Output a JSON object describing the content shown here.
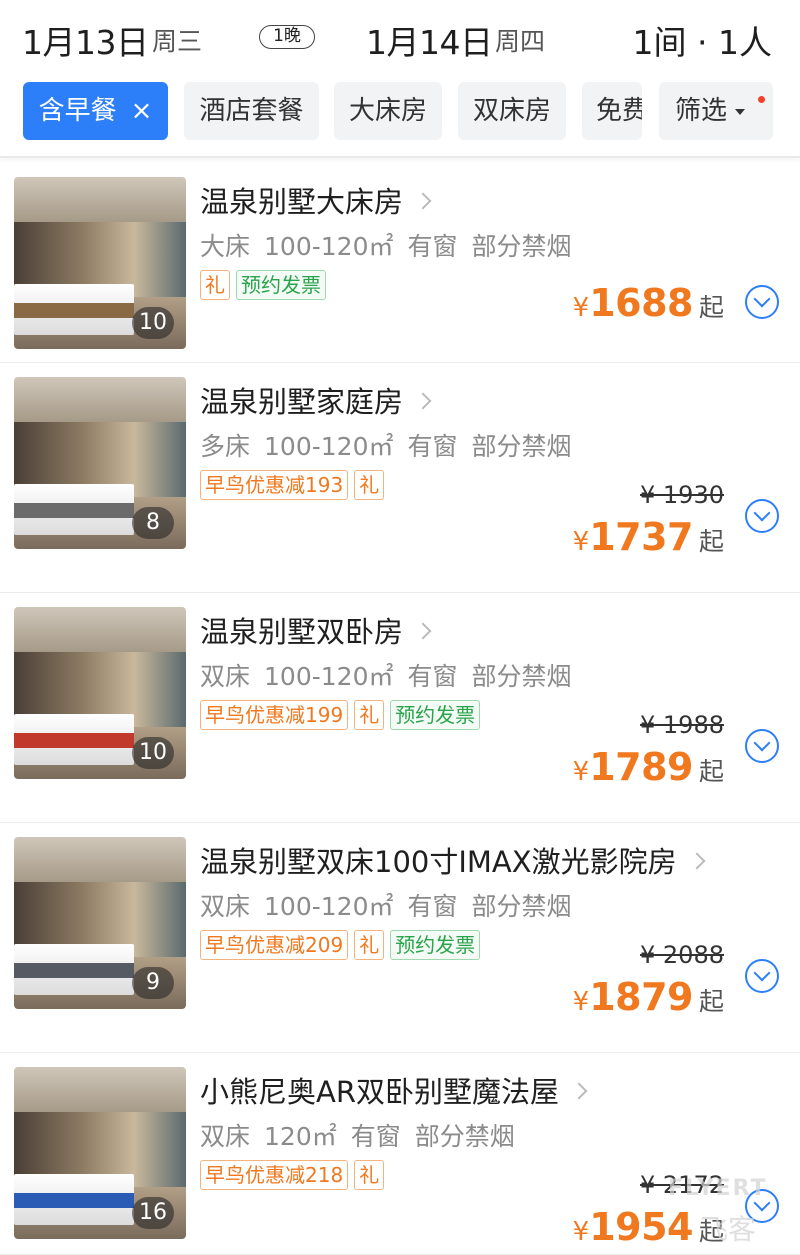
{
  "header": {
    "checkin_date": "1月13日",
    "checkin_weekday": "周三",
    "nights": "1晚",
    "checkout_date": "1月14日",
    "checkout_weekday": "周四",
    "rooms_guests": "1间 · 1人"
  },
  "filters": {
    "chips": [
      "含早餐",
      "酒店套餐",
      "大床房",
      "双床房",
      "免费"
    ],
    "active_chip_close": "×",
    "filter_label": "筛选",
    "active_color": "#2d7ff9"
  },
  "rooms": [
    {
      "title": "温泉别墅大床房",
      "bed": "大床",
      "area": "100-120㎡",
      "window": "有窗",
      "smoking": "部分禁烟",
      "tags": [
        {
          "text": "礼",
          "style": "orange"
        },
        {
          "text": "预约发票",
          "style": "green"
        }
      ],
      "photo_count": "10",
      "original_price": "",
      "currency": "¥",
      "price": "1688",
      "price_suffix": "起"
    },
    {
      "title": "温泉别墅家庭房",
      "bed": "多床",
      "area": "100-120㎡",
      "window": "有窗",
      "smoking": "部分禁烟",
      "tags": [
        {
          "text": "早鸟优惠减193",
          "style": "orange"
        },
        {
          "text": "礼",
          "style": "orange"
        }
      ],
      "photo_count": "8",
      "original_price": "¥ 1930",
      "currency": "¥",
      "price": "1737",
      "price_suffix": "起"
    },
    {
      "title": "温泉别墅双卧房",
      "bed": "双床",
      "area": "100-120㎡",
      "window": "有窗",
      "smoking": "部分禁烟",
      "tags": [
        {
          "text": "早鸟优惠减199",
          "style": "orange"
        },
        {
          "text": "礼",
          "style": "orange"
        },
        {
          "text": "预约发票",
          "style": "green"
        }
      ],
      "photo_count": "10",
      "original_price": "¥ 1988",
      "currency": "¥",
      "price": "1789",
      "price_suffix": "起"
    },
    {
      "title": "温泉别墅双床100寸IMAX激光影院房",
      "bed": "双床",
      "area": "100-120㎡",
      "window": "有窗",
      "smoking": "部分禁烟",
      "tags": [
        {
          "text": "早鸟优惠减209",
          "style": "orange"
        },
        {
          "text": "礼",
          "style": "orange"
        },
        {
          "text": "预约发票",
          "style": "green"
        }
      ],
      "photo_count": "9",
      "original_price": "¥ 2088",
      "currency": "¥",
      "price": "1879",
      "price_suffix": "起"
    },
    {
      "title": "小熊尼奥AR双卧别墅魔法屋",
      "bed": "双床",
      "area": "120㎡",
      "window": "有窗",
      "smoking": "部分禁烟",
      "tags": [
        {
          "text": "早鸟优惠减218",
          "style": "orange"
        },
        {
          "text": "礼",
          "style": "orange"
        }
      ],
      "photo_count": "16",
      "original_price": "¥ 2172",
      "currency": "¥",
      "price": "1954",
      "price_suffix": "起"
    }
  ],
  "watermark": {
    "line1": "FLYERT",
    "line2": "飞客"
  },
  "colors": {
    "price": "#f0781e",
    "accent": "#2d7ff9"
  }
}
